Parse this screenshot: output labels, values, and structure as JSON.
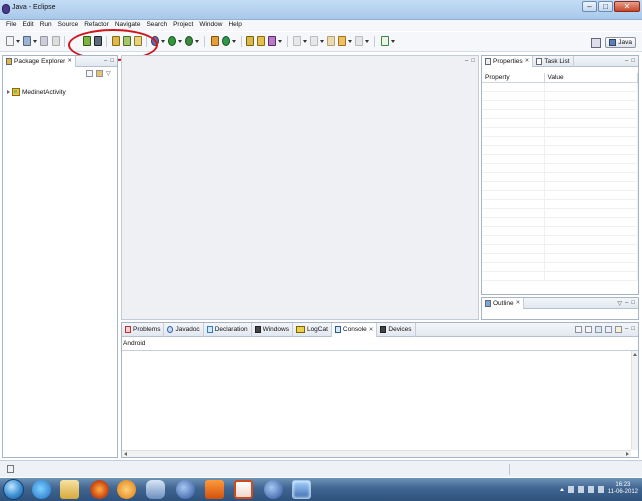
{
  "window": {
    "title": "Java - Eclipse"
  },
  "menu": [
    "File",
    "Edit",
    "Run",
    "Source",
    "Refactor",
    "Navigate",
    "Search",
    "Project",
    "Window",
    "Help"
  ],
  "perspective": {
    "label": "Java"
  },
  "package_explorer": {
    "tab_label": "Package Explorer",
    "tree_items": [
      {
        "label": "MedinetActivity"
      }
    ]
  },
  "properties_view": {
    "tabs": [
      {
        "label": "Properties"
      },
      {
        "label": "Task List"
      }
    ],
    "columns": [
      "Property",
      "Value"
    ]
  },
  "outline_view": {
    "tab_label": "Outline"
  },
  "bottom_views": {
    "tabs": [
      {
        "label": "Problems",
        "icon": "problems-icon",
        "color": "#c03030"
      },
      {
        "label": "Javadoc",
        "icon": "javadoc-icon",
        "color": "#3060b0"
      },
      {
        "label": "Declaration",
        "icon": "declaration-icon",
        "color": "#3080c0"
      },
      {
        "label": "Windows",
        "icon": "device-icon",
        "color": "#333333"
      },
      {
        "label": "LogCat",
        "icon": "logcat-icon",
        "color": "#c0a000"
      },
      {
        "label": "Console",
        "icon": "console-icon",
        "color": "#2060a0",
        "active": true
      },
      {
        "label": "Devices",
        "icon": "device-icon",
        "color": "#333333"
      }
    ],
    "console_name": "Android"
  },
  "taskbar": {
    "clock_time": "16:23",
    "clock_date": "11-06-2012",
    "apps": [
      "ie-icon",
      "explorer-icon",
      "firefox-icon",
      "media-player-icon",
      "virtualbox-icon",
      "globe-icon",
      "xampp-icon",
      "powerpoint-icon",
      "globe-icon",
      "eclipse-icon"
    ]
  },
  "colors": {
    "highlight_ellipse": "#d0161c",
    "title_bar": "#b8d4f0",
    "taskbar": "#3f6590"
  }
}
